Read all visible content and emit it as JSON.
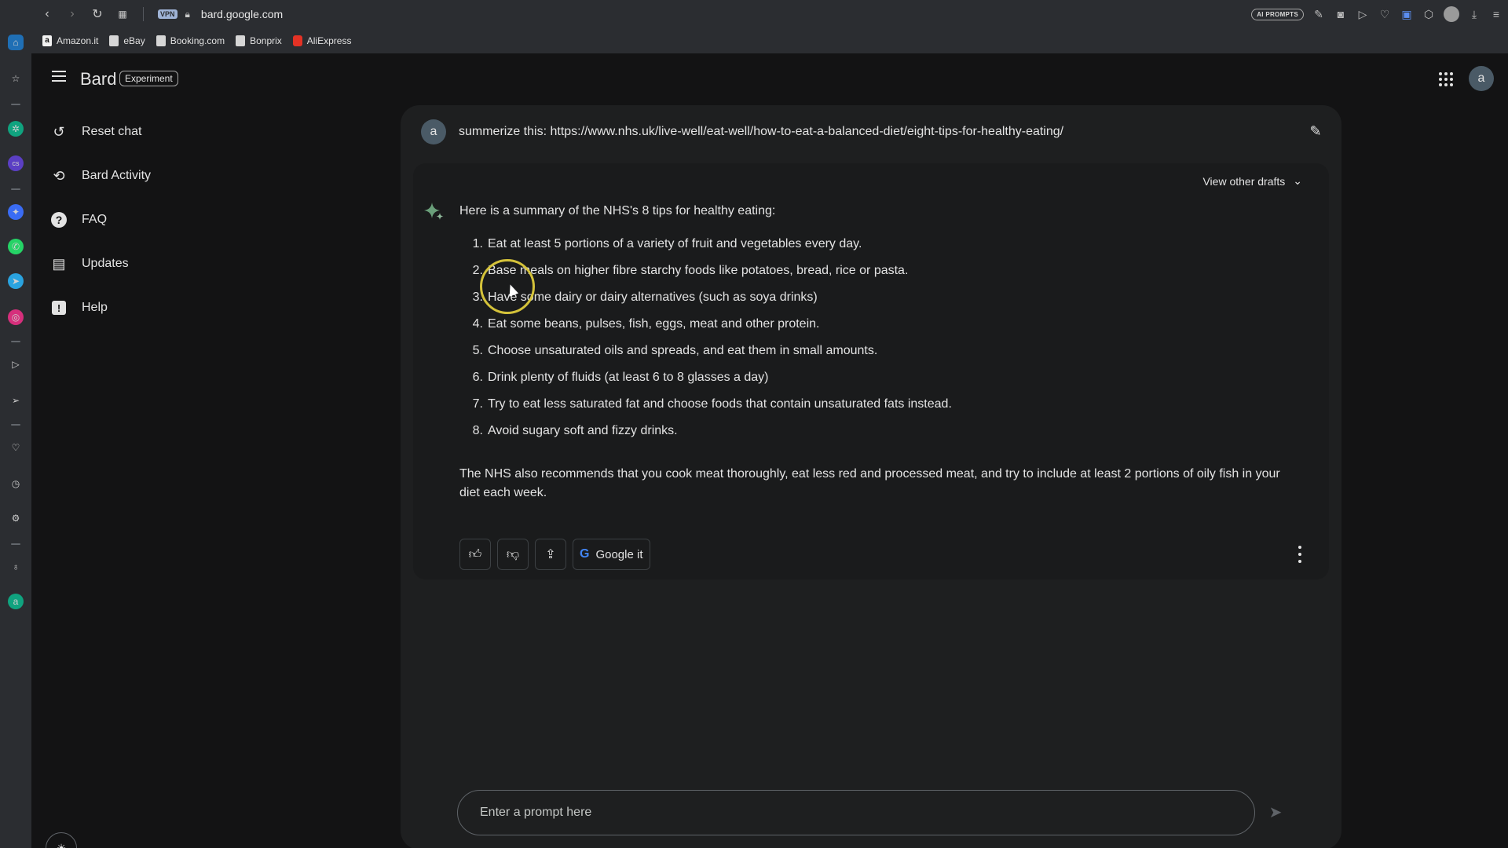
{
  "browser": {
    "url": "bard.google.com",
    "vpn_label": "VPN",
    "ai_prompts_label": "AI PROMPTS",
    "bookmarks": [
      {
        "label": "Amazon.it",
        "icon": "amazon-icon"
      },
      {
        "label": "eBay",
        "icon": "page-icon"
      },
      {
        "label": "Booking.com",
        "icon": "page-icon"
      },
      {
        "label": "Bonprix",
        "icon": "page-icon"
      },
      {
        "label": "AliExpress",
        "icon": "aliexpress-icon"
      }
    ]
  },
  "header": {
    "title": "Bard",
    "badge": "Experiment",
    "avatar_letter": "a"
  },
  "nav": {
    "items": [
      {
        "label": "Reset chat",
        "icon": "reset-icon"
      },
      {
        "label": "Bard Activity",
        "icon": "history-icon"
      },
      {
        "label": "FAQ",
        "icon": "help-circle-icon"
      },
      {
        "label": "Updates",
        "icon": "calendar-icon"
      },
      {
        "label": "Help",
        "icon": "feedback-icon"
      }
    ]
  },
  "prompt": {
    "avatar_letter": "a",
    "text": "summerize this: https://www.nhs.uk/live-well/eat-well/how-to-eat-a-balanced-diet/eight-tips-for-healthy-eating/"
  },
  "response": {
    "drafts_label": "View other drafts",
    "intro": "Here is a summary of the NHS's 8 tips for healthy eating:",
    "tips": [
      {
        "num": "1.",
        "text": "Eat at least 5 portions of a variety of fruit and vegetables every day."
      },
      {
        "num": "2.",
        "text": "Base meals on higher fibre starchy foods like potatoes, bread, rice or pasta."
      },
      {
        "num": "3.",
        "text": "Have some dairy or dairy alternatives (such as soya drinks)"
      },
      {
        "num": "4.",
        "text": "Eat some beans, pulses, fish, eggs, meat and other protein."
      },
      {
        "num": "5.",
        "text": "Choose unsaturated oils and spreads, and eat them in small amounts."
      },
      {
        "num": "6.",
        "text": "Drink plenty of fluids (at least 6 to 8 glasses a day)"
      },
      {
        "num": "7.",
        "text": "Try to eat less saturated fat and choose foods that contain unsaturated fats instead."
      },
      {
        "num": "8.",
        "text": "Avoid sugary soft and fizzy drinks."
      }
    ],
    "outro": "The NHS also recommends that you cook meat thoroughly, eat less red and processed meat, and try to include at least 2 portions of oily fish in your diet each week.",
    "google_it_label": "Google it"
  },
  "input": {
    "placeholder": "Enter a prompt here"
  }
}
